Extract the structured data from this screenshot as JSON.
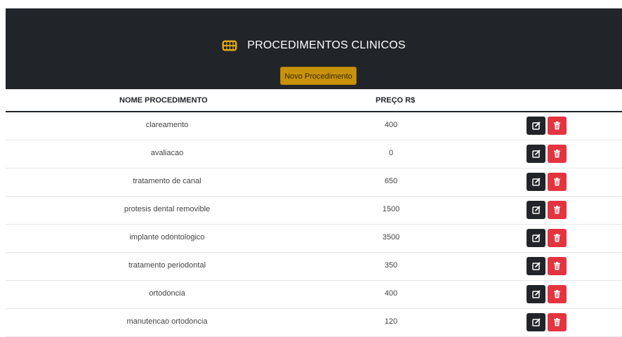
{
  "header": {
    "title": "PROCEDIMENTOS CLINICOS",
    "title_icon": "teeth-icon",
    "new_button_label": "Novo Procedimento"
  },
  "table": {
    "columns": [
      "NOME PROCEDIMENTO",
      "PREÇO R$"
    ],
    "rows": [
      {
        "name": "clareamento",
        "price": "400"
      },
      {
        "name": "avaliacao",
        "price": "0"
      },
      {
        "name": "tratamento de canal",
        "price": "650"
      },
      {
        "name": "protesis dental removible",
        "price": "1500"
      },
      {
        "name": "implante odontologico",
        "price": "3500"
      },
      {
        "name": "tratamento periodontal",
        "price": "350"
      },
      {
        "name": "ortodoncia",
        "price": "400"
      },
      {
        "name": "manutencao ortodoncia",
        "price": "120"
      }
    ],
    "row_actions": [
      "edit-icon",
      "trash-icon"
    ]
  },
  "colors": {
    "header_bg": "#212529",
    "new_button": "#c8920a",
    "edit_button": "#212529",
    "delete_button": "#e3343f"
  }
}
